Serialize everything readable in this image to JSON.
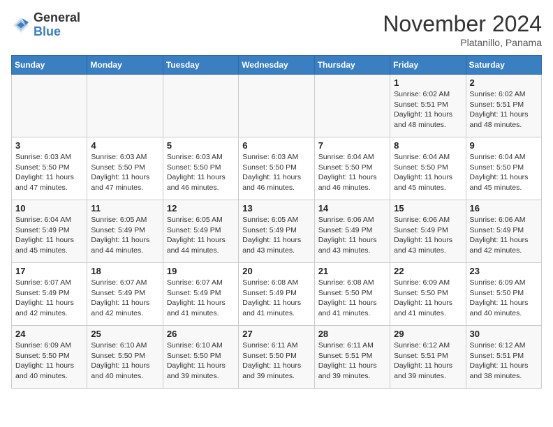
{
  "header": {
    "logo_line1": "General",
    "logo_line2": "Blue",
    "month": "November 2024",
    "location": "Platanillo, Panama"
  },
  "days_of_week": [
    "Sunday",
    "Monday",
    "Tuesday",
    "Wednesday",
    "Thursday",
    "Friday",
    "Saturday"
  ],
  "weeks": [
    [
      {
        "day": "",
        "info": ""
      },
      {
        "day": "",
        "info": ""
      },
      {
        "day": "",
        "info": ""
      },
      {
        "day": "",
        "info": ""
      },
      {
        "day": "",
        "info": ""
      },
      {
        "day": "1",
        "info": "Sunrise: 6:02 AM\nSunset: 5:51 PM\nDaylight: 11 hours\nand 48 minutes."
      },
      {
        "day": "2",
        "info": "Sunrise: 6:02 AM\nSunset: 5:51 PM\nDaylight: 11 hours\nand 48 minutes."
      }
    ],
    [
      {
        "day": "3",
        "info": "Sunrise: 6:03 AM\nSunset: 5:50 PM\nDaylight: 11 hours\nand 47 minutes."
      },
      {
        "day": "4",
        "info": "Sunrise: 6:03 AM\nSunset: 5:50 PM\nDaylight: 11 hours\nand 47 minutes."
      },
      {
        "day": "5",
        "info": "Sunrise: 6:03 AM\nSunset: 5:50 PM\nDaylight: 11 hours\nand 46 minutes."
      },
      {
        "day": "6",
        "info": "Sunrise: 6:03 AM\nSunset: 5:50 PM\nDaylight: 11 hours\nand 46 minutes."
      },
      {
        "day": "7",
        "info": "Sunrise: 6:04 AM\nSunset: 5:50 PM\nDaylight: 11 hours\nand 46 minutes."
      },
      {
        "day": "8",
        "info": "Sunrise: 6:04 AM\nSunset: 5:50 PM\nDaylight: 11 hours\nand 45 minutes."
      },
      {
        "day": "9",
        "info": "Sunrise: 6:04 AM\nSunset: 5:50 PM\nDaylight: 11 hours\nand 45 minutes."
      }
    ],
    [
      {
        "day": "10",
        "info": "Sunrise: 6:04 AM\nSunset: 5:49 PM\nDaylight: 11 hours\nand 45 minutes."
      },
      {
        "day": "11",
        "info": "Sunrise: 6:05 AM\nSunset: 5:49 PM\nDaylight: 11 hours\nand 44 minutes."
      },
      {
        "day": "12",
        "info": "Sunrise: 6:05 AM\nSunset: 5:49 PM\nDaylight: 11 hours\nand 44 minutes."
      },
      {
        "day": "13",
        "info": "Sunrise: 6:05 AM\nSunset: 5:49 PM\nDaylight: 11 hours\nand 43 minutes."
      },
      {
        "day": "14",
        "info": "Sunrise: 6:06 AM\nSunset: 5:49 PM\nDaylight: 11 hours\nand 43 minutes."
      },
      {
        "day": "15",
        "info": "Sunrise: 6:06 AM\nSunset: 5:49 PM\nDaylight: 11 hours\nand 43 minutes."
      },
      {
        "day": "16",
        "info": "Sunrise: 6:06 AM\nSunset: 5:49 PM\nDaylight: 11 hours\nand 42 minutes."
      }
    ],
    [
      {
        "day": "17",
        "info": "Sunrise: 6:07 AM\nSunset: 5:49 PM\nDaylight: 11 hours\nand 42 minutes."
      },
      {
        "day": "18",
        "info": "Sunrise: 6:07 AM\nSunset: 5:49 PM\nDaylight: 11 hours\nand 42 minutes."
      },
      {
        "day": "19",
        "info": "Sunrise: 6:07 AM\nSunset: 5:49 PM\nDaylight: 11 hours\nand 41 minutes."
      },
      {
        "day": "20",
        "info": "Sunrise: 6:08 AM\nSunset: 5:49 PM\nDaylight: 11 hours\nand 41 minutes."
      },
      {
        "day": "21",
        "info": "Sunrise: 6:08 AM\nSunset: 5:50 PM\nDaylight: 11 hours\nand 41 minutes."
      },
      {
        "day": "22",
        "info": "Sunrise: 6:09 AM\nSunset: 5:50 PM\nDaylight: 11 hours\nand 41 minutes."
      },
      {
        "day": "23",
        "info": "Sunrise: 6:09 AM\nSunset: 5:50 PM\nDaylight: 11 hours\nand 40 minutes."
      }
    ],
    [
      {
        "day": "24",
        "info": "Sunrise: 6:09 AM\nSunset: 5:50 PM\nDaylight: 11 hours\nand 40 minutes."
      },
      {
        "day": "25",
        "info": "Sunrise: 6:10 AM\nSunset: 5:50 PM\nDaylight: 11 hours\nand 40 minutes."
      },
      {
        "day": "26",
        "info": "Sunrise: 6:10 AM\nSunset: 5:50 PM\nDaylight: 11 hours\nand 39 minutes."
      },
      {
        "day": "27",
        "info": "Sunrise: 6:11 AM\nSunset: 5:50 PM\nDaylight: 11 hours\nand 39 minutes."
      },
      {
        "day": "28",
        "info": "Sunrise: 6:11 AM\nSunset: 5:51 PM\nDaylight: 11 hours\nand 39 minutes."
      },
      {
        "day": "29",
        "info": "Sunrise: 6:12 AM\nSunset: 5:51 PM\nDaylight: 11 hours\nand 39 minutes."
      },
      {
        "day": "30",
        "info": "Sunrise: 6:12 AM\nSunset: 5:51 PM\nDaylight: 11 hours\nand 38 minutes."
      }
    ]
  ]
}
